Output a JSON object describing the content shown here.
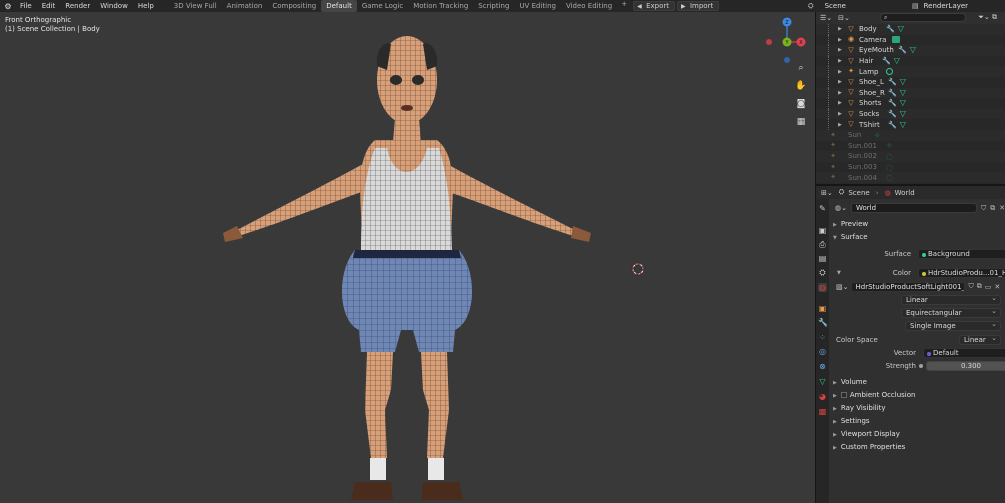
{
  "topbar": {
    "menu": [
      "File",
      "Edit",
      "Render",
      "Window",
      "Help"
    ],
    "workspaces": [
      "3D View Full",
      "Animation",
      "Compositing",
      "Default",
      "Game Logic",
      "Motion Tracking",
      "Scripting",
      "UV Editing",
      "Video Editing"
    ],
    "active_workspace": "Default",
    "plus": "+",
    "export_label": "Export",
    "import_label": "Import",
    "scene": "Scene",
    "render_layer": "RenderLayer"
  },
  "viewport": {
    "view_name": "Front Orthographic",
    "collection_info": "(1) Scene Collection | Body",
    "gizmo": {
      "x": "X",
      "y": "Y",
      "z": "Z"
    }
  },
  "outliner": {
    "search_placeholder": "",
    "children": [
      {
        "name": "Body"
      },
      {
        "name": "Camera"
      },
      {
        "name": "EyeMouth"
      },
      {
        "name": "Hair"
      },
      {
        "name": "Lamp"
      },
      {
        "name": "Shoe_L"
      },
      {
        "name": "Shoe_R"
      },
      {
        "name": "Shorts"
      },
      {
        "name": "Socks"
      },
      {
        "name": "TShirt"
      }
    ],
    "suns": [
      {
        "name": "Sun"
      },
      {
        "name": "Sun.001"
      },
      {
        "name": "Sun.002"
      },
      {
        "name": "Sun.003"
      },
      {
        "name": "Sun.004"
      }
    ]
  },
  "properties": {
    "breadcrumb_scene": "Scene",
    "breadcrumb_world": "World",
    "world_name": "World",
    "panels": {
      "preview": "Preview",
      "surface": "Surface",
      "volume": "Volume",
      "ambient_occlusion": "Ambient Occlusion",
      "ray_visibility": "Ray Visibility",
      "settings": "Settings",
      "viewport_display": "Viewport Display",
      "custom_properties": "Custom Properties"
    },
    "surface_label": "Surface",
    "surface_value": "Background",
    "color_label": "Color",
    "color_value": "HdrStudioProdu...01_HDR_4K.exr",
    "image_name": "HdrStudioProductSoftLight001_HDR_4K...",
    "interpolation": "Linear",
    "projection": "Equirectangular",
    "source": "Single Image",
    "color_space_label": "Color Space",
    "color_space_value": "Linear",
    "vector_label": "Vector",
    "vector_value": "Default",
    "strength_label": "Strength",
    "strength_value": "0.300"
  },
  "colors": {
    "viewport_bg": "#393939",
    "accent_green": "#2fce93",
    "accent_orange": "#e69c4a",
    "axis_x": "#e0404f",
    "axis_y": "#7bb31f",
    "axis_z": "#3d8ae6"
  }
}
